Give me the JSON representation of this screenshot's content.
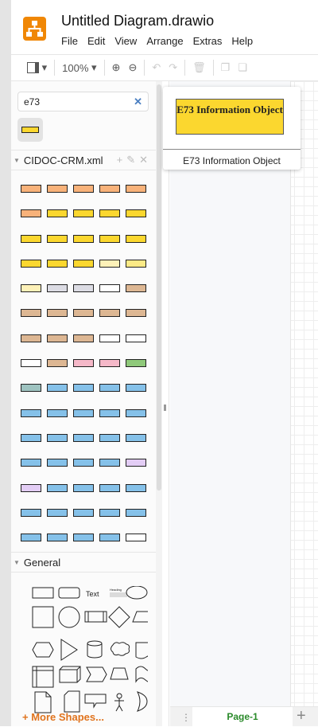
{
  "app": {
    "title": "Untitled Diagram.drawio",
    "menu": [
      "File",
      "Edit",
      "View",
      "Arrange",
      "Extras",
      "Help"
    ]
  },
  "toolbar": {
    "zoom": "100%"
  },
  "search": {
    "value": "e73",
    "clear_icon": "close-icon"
  },
  "sections": {
    "cidoc": "CIDOC-CRM.xml",
    "general": "General"
  },
  "cidoc_colors": [
    [
      "#f8b27a",
      "#f8b27a",
      "#f8b27a",
      "#f8b27a",
      "#f8b27a"
    ],
    [
      "#f8b27a",
      "#fbd72f",
      "#fbd72f",
      "#fbd72f",
      "#fbd72f"
    ],
    [
      "#fbd72f",
      "#fbd72f",
      "#fbd72f",
      "#fbd72f",
      "#fbd72f"
    ],
    [
      "#fbd72f",
      "#fbd72f",
      "#fbd72f",
      "#fdf1b8",
      "#fcea86"
    ],
    [
      "#fdf1b8",
      "#dcdce4",
      "#dcdce4",
      "#ffffff",
      "#ddb793"
    ],
    [
      "#ddb793",
      "#ddb793",
      "#ddb793",
      "#ddb793",
      "#ddb793"
    ],
    [
      "#ddb793",
      "#ddb793",
      "#ddb793",
      "#ffffff",
      "#ffffff"
    ],
    [
      "#ffffff",
      "#ddb793",
      "#f5b8c8",
      "#f5b8c8",
      "#8fc97a"
    ],
    [
      "#9ec3c0",
      "#85c1e9",
      "#85c1e9",
      "#85c1e9",
      "#85c1e9"
    ],
    [
      "#85c1e9",
      "#85c1e9",
      "#85c1e9",
      "#85c1e9",
      "#85c1e9"
    ],
    [
      "#85c1e9",
      "#85c1e9",
      "#85c1e9",
      "#85c1e9",
      "#85c1e9"
    ],
    [
      "#85c1e9",
      "#85c1e9",
      "#85c1e9",
      "#85c1e9",
      "#e3cdf5"
    ],
    [
      "#e3cdf5",
      "#85c1e9",
      "#85c1e9",
      "#85c1e9",
      "#85c1e9"
    ],
    [
      "#85c1e9",
      "#85c1e9",
      "#85c1e9",
      "#85c1e9",
      "#85c1e9"
    ],
    [
      "#85c1e9",
      "#85c1e9",
      "#85c1e9",
      "#85c1e9",
      "#ffffff"
    ]
  ],
  "general_shapes": {
    "text": "Text",
    "heading": "Heading"
  },
  "more_shapes": "+ More Shapes...",
  "popup": {
    "shape_text": "E73 Information Object",
    "label": "E73 Information Object",
    "fill": "#fbd72f"
  },
  "pages": {
    "current": "Page-1"
  },
  "accent": "#f08705"
}
